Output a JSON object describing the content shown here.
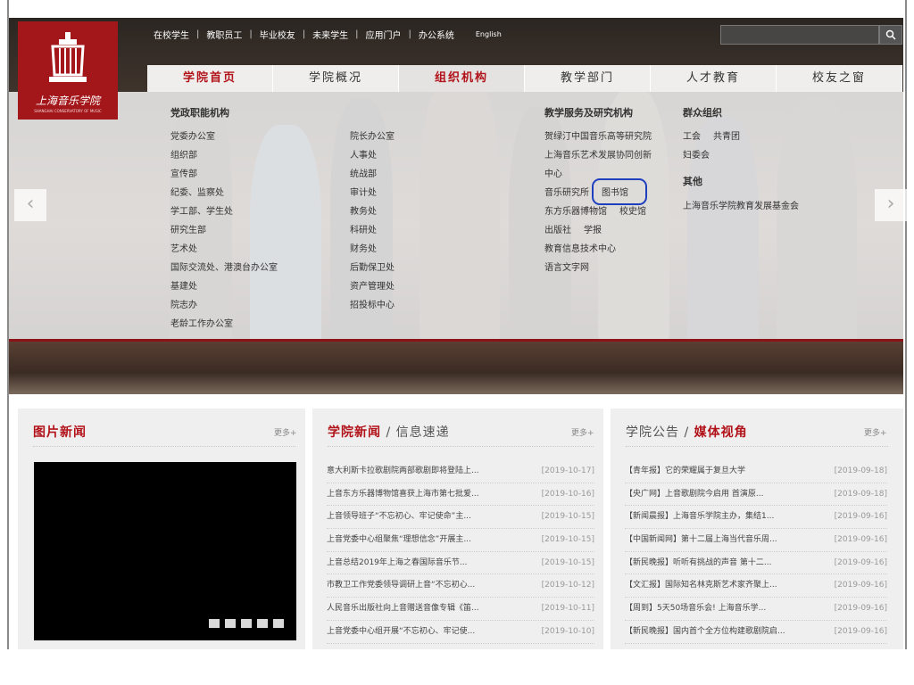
{
  "logo": {
    "name": "上海音乐学院",
    "subtitle": "SHANGHAI CONSERVATORY OF MUSIC"
  },
  "top_links": [
    "在校学生",
    "教职员工",
    "毕业校友",
    "未来学生",
    "应用门户",
    "办公系统",
    "English"
  ],
  "search": {
    "placeholder": "",
    "button_icon": "search-icon"
  },
  "main_nav": [
    "学院首页",
    "学院概况",
    "组织机构",
    "教学部门",
    "人才教育",
    "校友之窗"
  ],
  "menu": {
    "headers": {
      "admin": "党政职能机构",
      "teaching": "教学服务及研究机构",
      "mass": "群众组织",
      "other": "其他"
    },
    "col1": [
      "党委办公室",
      "组织部",
      "宣传部",
      "纪委、监察处",
      "学工部、学生处",
      "研究生部",
      "艺术处",
      "国际交流处、港澳台办公室",
      "基建处",
      "院志办",
      "老龄工作办公室"
    ],
    "col2": [
      "院长办公室",
      "人事处",
      "统战部",
      "审计处",
      "教务处",
      "科研处",
      "财务处",
      "后勤保卫处",
      "资产管理处",
      "招投标中心"
    ],
    "col3": [
      "贺绿汀中国音乐高等研究院",
      "上海音乐艺术发展协同创新",
      "中心",
      "音乐研究所",
      "图书馆",
      "东方乐器博物馆",
      "校史馆",
      "出版社",
      "学报",
      "教育信息技术中心",
      "语言文字网"
    ],
    "col4_mass": [
      "工会",
      "共青团",
      "妇委会"
    ],
    "col4_other": [
      "上海音乐学院教育发展基金会"
    ]
  },
  "panels": {
    "photo_news": {
      "title": "图片新闻",
      "more": "更多+"
    },
    "news": {
      "title_a": "学院新闻",
      "slash": " / ",
      "title_b": "信息速递",
      "more": "更多+",
      "items": [
        {
          "title": "意大利斯卡拉歌剧院两部歌剧即将登陆上...",
          "date": "[2019-10-17]"
        },
        {
          "title": "上音东方乐器博物馆喜获上海市第七批爱...",
          "date": "[2019-10-16]"
        },
        {
          "title": "上音领导班子“不忘初心、牢记使命”主...",
          "date": "[2019-10-15]"
        },
        {
          "title": "上音党委中心组聚焦“理想信念”开展主...",
          "date": "[2019-10-15]"
        },
        {
          "title": "上音总结2019年上海之春国际音乐节...",
          "date": "[2019-10-15]"
        },
        {
          "title": "市教卫工作党委领导调研上音“不忘初心...",
          "date": "[2019-10-12]"
        },
        {
          "title": "人民音乐出版社向上音赠送音像专辑《笛...",
          "date": "[2019-10-11]"
        },
        {
          "title": "上音党委中心组开展“不忘初心、牢记使...",
          "date": "[2019-10-10]"
        }
      ]
    },
    "notice": {
      "title_a": "学院公告",
      "slash": " / ",
      "title_b": "媒体视角",
      "more": "更多+",
      "items": [
        {
          "title": "【青年报】它的荣耀属于复旦大学",
          "date": "[2019-09-18]"
        },
        {
          "title": "【央广网】上音歌剧院今启用 首演原...",
          "date": "[2019-09-18]"
        },
        {
          "title": "【新闻晨报】上海音乐学院主办，集结1...",
          "date": "[2019-09-16]"
        },
        {
          "title": "【中国新闻网】第十二届上海当代音乐周...",
          "date": "[2019-09-16]"
        },
        {
          "title": "【新民晚报】听听有挑战的声音 第十二...",
          "date": "[2019-09-16]"
        },
        {
          "title": "【文汇报】国际知名林克斯艺术家齐聚上...",
          "date": "[2019-09-16]"
        },
        {
          "title": "【周到】5天50场音乐会! 上海音乐学...",
          "date": "[2019-09-16]"
        },
        {
          "title": "【新民晚报】国内首个全方位构建歌剧院启...",
          "date": "[2019-09-16]"
        }
      ]
    }
  },
  "colors": {
    "brand_red": "#a3161a",
    "highlight_circle": "#1f3fbf"
  }
}
